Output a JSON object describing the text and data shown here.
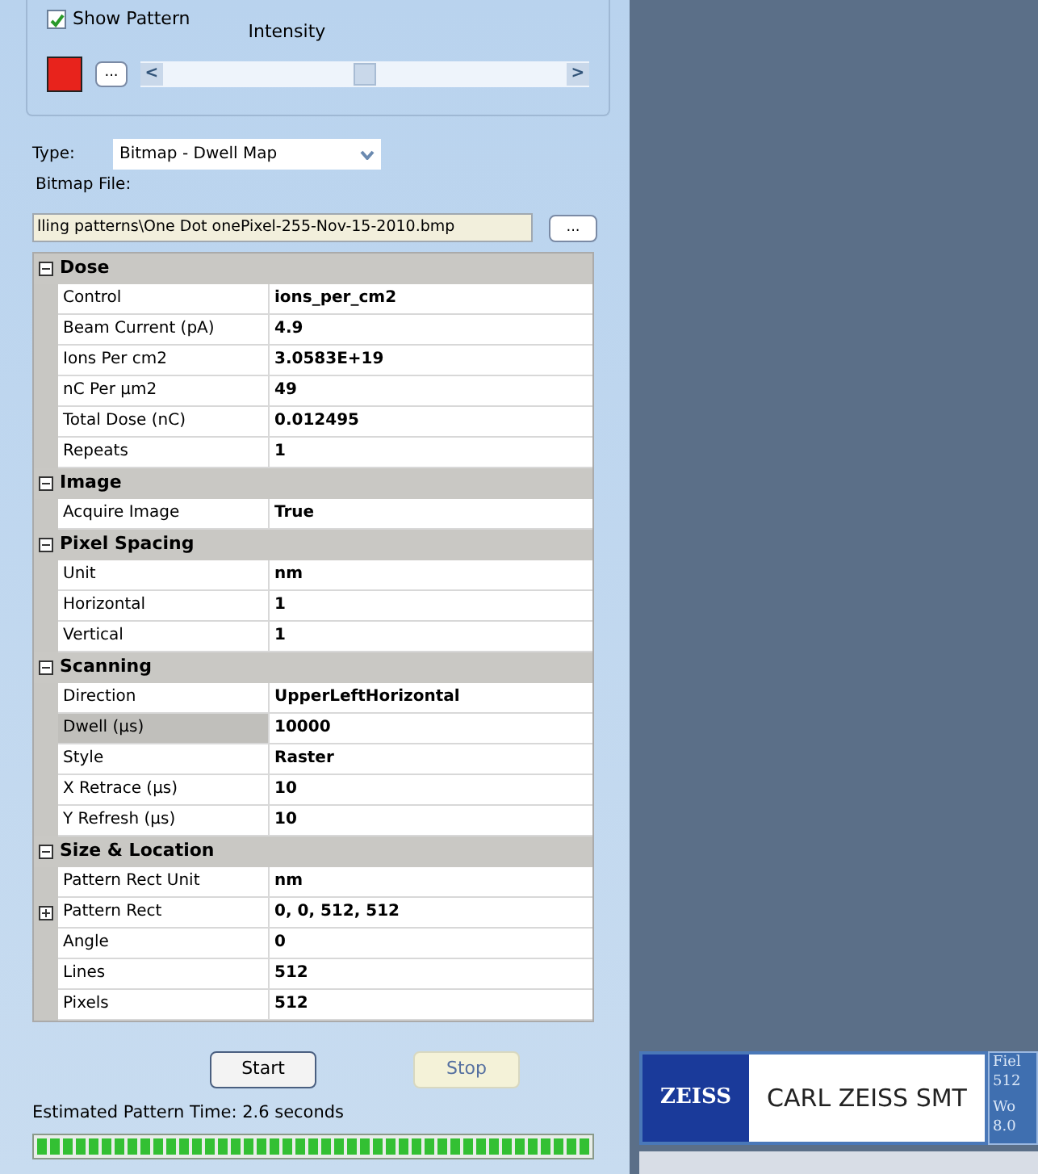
{
  "pattern": {
    "show_pattern": {
      "label": "Show Pattern",
      "checked": true
    },
    "intensity": {
      "label": "Intensity",
      "level": 0.5
    },
    "swatch": {
      "color": "#e8231c"
    },
    "color_button": "...",
    "scroll_left": "<",
    "scroll_right": ">"
  },
  "type": {
    "label": "Type:",
    "value": "Bitmap - Dwell Map"
  },
  "bitmap_file": {
    "label": "Bitmap File:",
    "value": "lling patterns\\One Dot onePixel-255-Nov-15-2010.bmp",
    "browse": "..."
  },
  "properties": [
    {
      "name": "Dose",
      "expanded": true,
      "rows": [
        {
          "label": "Control",
          "value": "ions_per_cm2",
          "selected": false
        },
        {
          "label": "Beam Current (pA)",
          "value": "4.9",
          "selected": false
        },
        {
          "label": "Ions Per cm2",
          "value": "3.0583E+19",
          "selected": false
        },
        {
          "label": "nC Per µm2",
          "value": "49",
          "selected": false
        },
        {
          "label": "Total Dose (nC)",
          "value": "0.012495",
          "selected": false
        },
        {
          "label": "Repeats",
          "value": "1",
          "selected": false
        }
      ]
    },
    {
      "name": "Image",
      "expanded": true,
      "rows": [
        {
          "label": "Acquire Image",
          "value": "True",
          "selected": false
        }
      ]
    },
    {
      "name": "Pixel Spacing",
      "expanded": true,
      "rows": [
        {
          "label": "Unit",
          "value": "nm",
          "selected": false
        },
        {
          "label": "Horizontal",
          "value": "1",
          "selected": false
        },
        {
          "label": "Vertical",
          "value": "1",
          "selected": false
        }
      ]
    },
    {
      "name": "Scanning",
      "expanded": true,
      "rows": [
        {
          "label": "Direction",
          "value": "UpperLeftHorizontal",
          "selected": false
        },
        {
          "label": "Dwell (µs)",
          "value": "10000",
          "selected": true
        },
        {
          "label": "Style",
          "value": "Raster",
          "selected": false
        },
        {
          "label": "X Retrace (µs)",
          "value": "10",
          "selected": false
        },
        {
          "label": "Y Refresh (µs)",
          "value": "10",
          "selected": false
        }
      ]
    },
    {
      "name": "Size & Location",
      "expanded": true,
      "rows": [
        {
          "label": "Pattern Rect Unit",
          "value": "nm",
          "selected": false
        },
        {
          "label": "Pattern Rect",
          "value": "0, 0, 512, 512",
          "selected": false,
          "expanded": false
        },
        {
          "label": "Angle",
          "value": "0",
          "selected": false
        },
        {
          "label": "Lines",
          "value": "512",
          "selected": false
        },
        {
          "label": "Pixels",
          "value": "512",
          "selected": false
        }
      ]
    }
  ],
  "buttons": [
    {
      "label": "Start",
      "disabled": false
    },
    {
      "label": "Stop",
      "disabled": true
    }
  ],
  "estimate": "Estimated Pattern Time: 2.6 seconds",
  "progress": {
    "level": 1
  },
  "logo": {
    "mark": "ZEISS",
    "company": "CARL ZEISS SMT"
  },
  "info": {
    "line_1": "Fiel",
    "line_2": "512",
    "line_3": "Wo",
    "line_4": "8.0"
  }
}
